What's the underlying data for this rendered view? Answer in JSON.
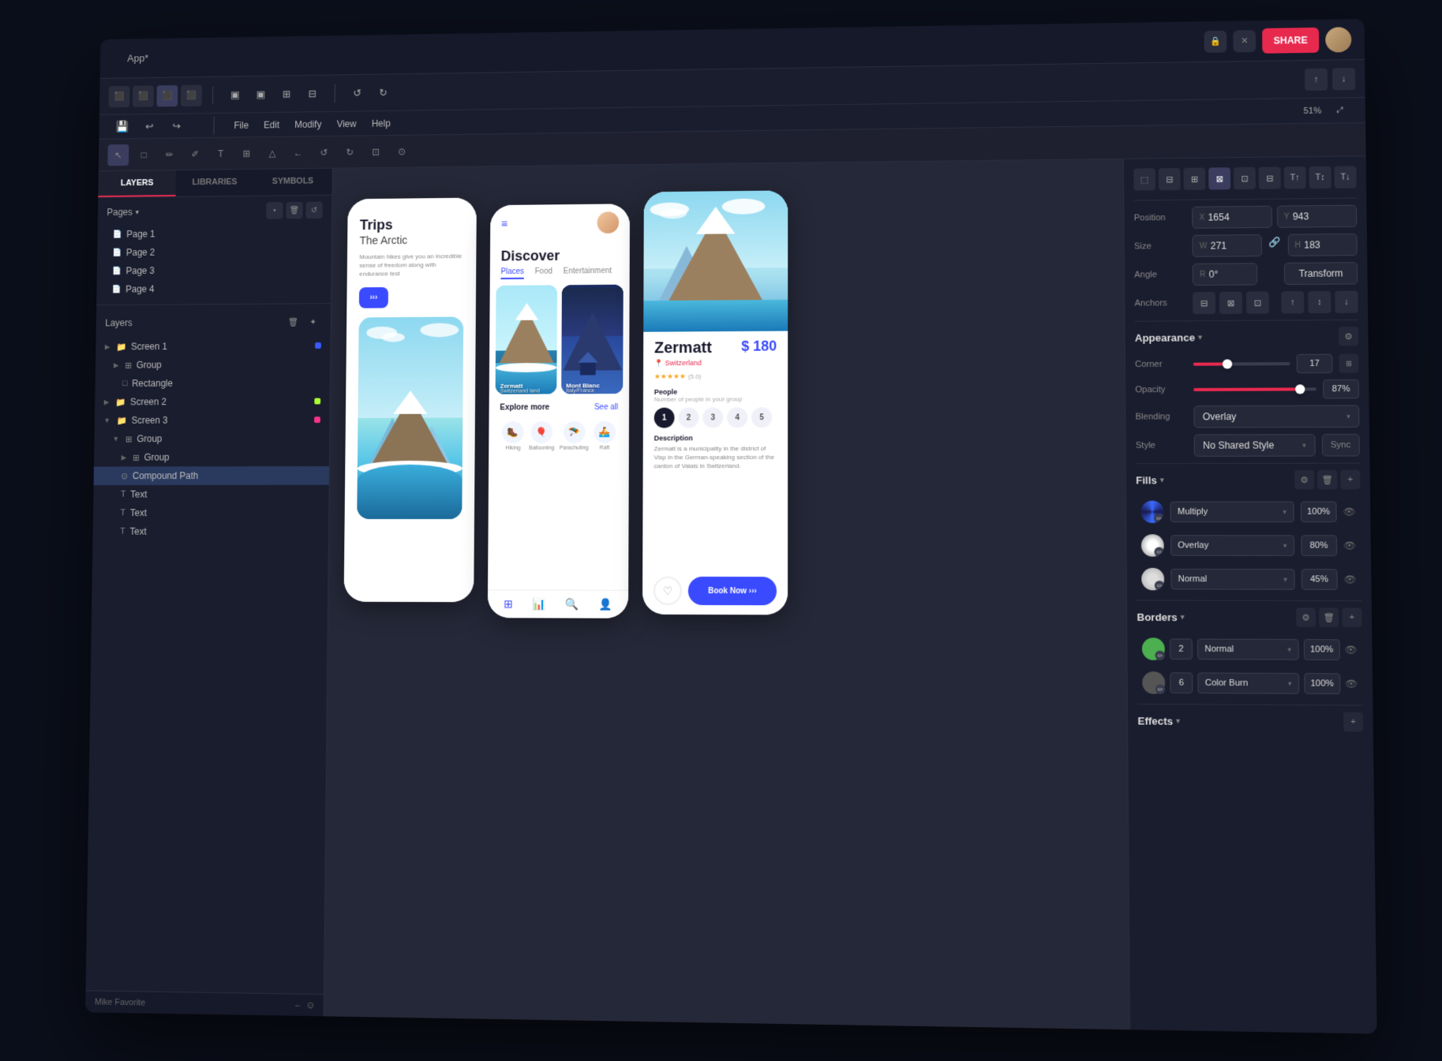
{
  "app": {
    "title": "App*",
    "share_label": "SHARE"
  },
  "menu": {
    "items": [
      "File",
      "Edit",
      "Modify",
      "View",
      "Help"
    ]
  },
  "sidebar_tabs": {
    "tabs": [
      "LAYERS",
      "LIBRARIES",
      "SYMBOLS"
    ]
  },
  "pages": {
    "label": "Pages",
    "items": [
      "Page 1",
      "Page 2",
      "Page 3",
      "Page 4"
    ]
  },
  "layers": {
    "label": "Layers",
    "items": [
      {
        "name": "Screen 1",
        "type": "group",
        "indent": 0
      },
      {
        "name": "Group",
        "type": "group",
        "indent": 1
      },
      {
        "name": "Rectangle",
        "type": "rect",
        "indent": 2
      },
      {
        "name": "Screen 2",
        "type": "group",
        "indent": 0
      },
      {
        "name": "Screen 3",
        "type": "group",
        "indent": 0
      },
      {
        "name": "Group",
        "type": "group",
        "indent": 1
      },
      {
        "name": "Group",
        "type": "group",
        "indent": 2
      },
      {
        "name": "Compound Path",
        "type": "path",
        "indent": 2
      },
      {
        "name": "Text",
        "type": "text",
        "indent": 2
      },
      {
        "name": "Text",
        "type": "text",
        "indent": 2
      },
      {
        "name": "Text",
        "type": "text",
        "indent": 2
      }
    ]
  },
  "status_bar": {
    "user": "Mike Favorite",
    "zoom": "51%"
  },
  "right_panel": {
    "position": {
      "label": "Position",
      "x_label": "X",
      "x_value": "1654",
      "y_label": "Y",
      "y_value": "943"
    },
    "size": {
      "label": "Size",
      "w_label": "W",
      "w_value": "271",
      "h_label": "H",
      "h_value": "183"
    },
    "angle": {
      "label": "Angle",
      "r_label": "R",
      "r_value": "0°",
      "transform_label": "Transform"
    },
    "anchors": {
      "label": "Anchors"
    },
    "appearance": {
      "label": "Appearance",
      "corner_label": "Corner",
      "corner_value": "17",
      "opacity_label": "Opacity",
      "opacity_value": "87%",
      "blending_label": "Blending",
      "blending_value": "Overlay",
      "style_label": "Style",
      "style_value": "No Shared Style",
      "sync_label": "Sync"
    },
    "fills": {
      "label": "Fills",
      "items": [
        {
          "blend": "Multiply",
          "value": "100%"
        },
        {
          "blend": "Overlay",
          "value": "80%"
        },
        {
          "blend": "Normal",
          "value": "45%"
        }
      ]
    },
    "borders": {
      "label": "Borders",
      "items": [
        {
          "num": "2",
          "blend": "Normal",
          "value": "100%"
        },
        {
          "num": "6",
          "blend": "Color Burn",
          "value": "100%"
        }
      ]
    },
    "effects": {
      "label": "Effects"
    }
  },
  "phones": {
    "phone1": {
      "title": "Trips",
      "subtitle": "The Arctic",
      "desc": "Mountain hikes give you an incredible sense of freedom along with endurance test",
      "btn_label": "›››"
    },
    "phone2": {
      "title": "Discover",
      "tabs": [
        "Places",
        "Food",
        "Entertainment"
      ],
      "explore_label": "Explore more",
      "see_all": "See all",
      "icons": [
        "Hiking",
        "Ballooning",
        "Parachuting",
        "Raft"
      ]
    },
    "phone3": {
      "name": "Zermatt",
      "price": "$ 180",
      "location": "Switzerland",
      "rating": "★★★★★",
      "rating_count": "(5.0)",
      "people_label": "People",
      "people_sub": "Number of people in your group",
      "numbers": [
        "1",
        "2",
        "3",
        "4",
        "5"
      ],
      "desc_title": "Description",
      "desc_text": "Zermatt is a municipality in the district of Visp in the German-speaking section of the canton of Valais in Switzerland.",
      "heart_icon": "♡",
      "book_label": "Book Now  ›››"
    }
  }
}
